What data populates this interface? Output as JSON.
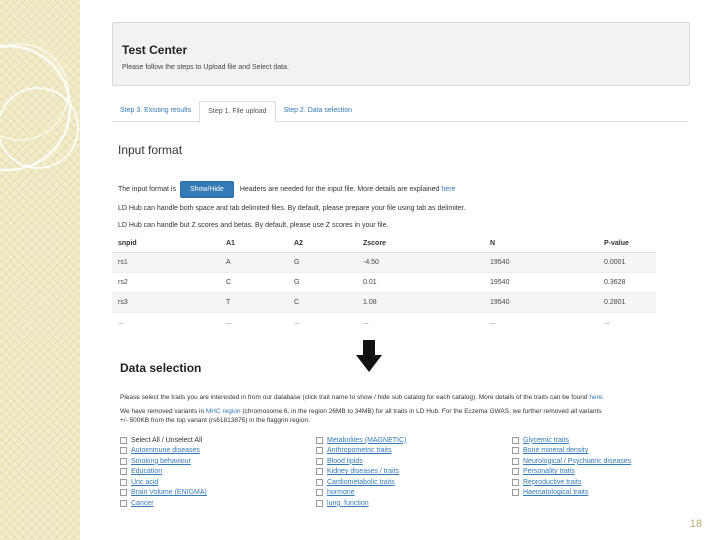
{
  "slide_number": "18",
  "panel": {
    "title": "Test Center",
    "subtitle": "Please follow the steps to Upload file and Select data."
  },
  "tabs": [
    {
      "label": "Step 3. Existing results",
      "active": false
    },
    {
      "label": "Step 1. File upload",
      "active": true
    },
    {
      "label": "Step 2. Data selection",
      "active": false
    }
  ],
  "input_format": {
    "heading": "Input format",
    "format_prefix": "The input format is",
    "button_label": "Show/Hide",
    "format_suffix": "Headers are needed for the input file. More details are explained",
    "here_link": "here",
    "info_line1": "LD Hub can handle both space and tab delimited files. By default, please prepare your file using tab as delimiter.",
    "info_line2": "LD Hub can handle but Z scores and betas. By default, please use Z scores in your file."
  },
  "table": {
    "headers": [
      "snpid",
      "A1",
      "A2",
      "Zscore",
      "N",
      "P-value"
    ],
    "rows": [
      [
        "rs1",
        "A",
        "G",
        "-4.50",
        "19540",
        "0.0001"
      ],
      [
        "rs2",
        "C",
        "G",
        "0.01",
        "19540",
        "0.3628"
      ],
      [
        "rs3",
        "T",
        "C",
        "1.08",
        "19540",
        "0.2801"
      ],
      [
        "...",
        "...",
        "...",
        "...",
        "...",
        "..."
      ]
    ]
  },
  "data_selection": {
    "heading": "Data selection",
    "line1": "Please select the traits you are interested in from our database (click trait name to show / hide sub catalog for each catalog). More details of the traits can be found",
    "line1_link": "here",
    "line2_prefix": "We have removed variants in",
    "line2_link": "MHC region",
    "line2_suffix": "(chromosome 6, in the region 26MB to 34MB) for all traits in LD Hub. For the Eczema GWAS, we further removed all variants",
    "line3": "+/- 500KB from the top variant (rs61813875) in the flaggrin region."
  },
  "traits": [
    {
      "label": "Select All / Unselect All",
      "link": false
    },
    {
      "label": "Metabolites (MAGNETIC)",
      "link": true
    },
    {
      "label": "Glycemic traits",
      "link": true
    },
    {
      "label": "Autoimmune diseases",
      "link": true
    },
    {
      "label": "Anthropometric traits",
      "link": true
    },
    {
      "label": "Bone mineral density",
      "link": true
    },
    {
      "label": "Smoking behaviour",
      "link": true
    },
    {
      "label": "Blood lipids",
      "link": true
    },
    {
      "label": "Neurological / Psychiatric diseases",
      "link": true
    },
    {
      "label": "Education",
      "link": true
    },
    {
      "label": "Kidney diseases / traits",
      "link": true
    },
    {
      "label": "Personality traits",
      "link": true
    },
    {
      "label": "Uric acid",
      "link": true
    },
    {
      "label": "Cardiometabolic traits",
      "link": true
    },
    {
      "label": "Reproductive traits",
      "link": true
    },
    {
      "label": "Brain Volume (ENIGMA)",
      "link": true
    },
    {
      "label": "hormone",
      "link": true
    },
    {
      "label": "Haematological traits",
      "link": true
    },
    {
      "label": "Cancer",
      "link": true
    },
    {
      "label": "lung_function",
      "link": true
    }
  ]
}
